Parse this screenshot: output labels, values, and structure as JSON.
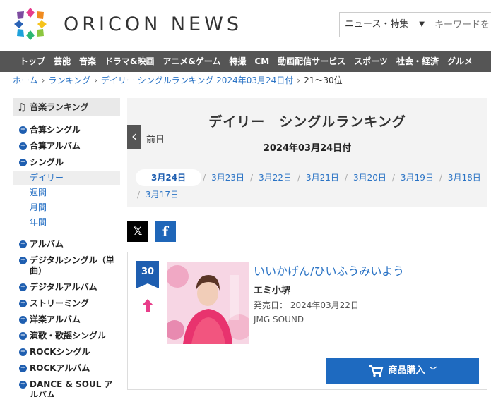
{
  "header": {
    "logo_text": "ORICON NEWS",
    "search_category": "ニュース・特集",
    "search_placeholder": "キーワードを"
  },
  "nav": {
    "items": [
      "トップ",
      "芸能",
      "音楽",
      "ドラマ&映画",
      "アニメ&ゲーム",
      "特撮",
      "CM",
      "動画配信サービス",
      "スポーツ",
      "社会・経済",
      "グルメ"
    ]
  },
  "breadcrumb": {
    "items": [
      "ホーム",
      "ランキング",
      "デイリー シングルランキング 2024年03月24日付"
    ],
    "current": "21～30位"
  },
  "sidebar": {
    "title": "音楽ランキング",
    "items": [
      {
        "label": "合算シングル",
        "mark": "+"
      },
      {
        "label": "合算アルバム",
        "mark": "+"
      },
      {
        "label": "シングル",
        "mark": "−"
      },
      {
        "label": "アルバム",
        "mark": "+"
      },
      {
        "label": "デジタルシングル（単曲）",
        "mark": "+"
      },
      {
        "label": "デジタルアルバム",
        "mark": "+"
      },
      {
        "label": "ストリーミング",
        "mark": "+"
      },
      {
        "label": "洋楽アルバム",
        "mark": "+"
      },
      {
        "label": "演歌・歌謡シングル",
        "mark": "+"
      },
      {
        "label": "ROCKシングル",
        "mark": "+"
      },
      {
        "label": "ROCKアルバム",
        "mark": "+"
      },
      {
        "label": "DANCE & SOUL アルバム",
        "mark": "+"
      }
    ],
    "subitems": [
      "デイリー",
      "週間",
      "月間",
      "年間"
    ]
  },
  "ranking": {
    "title": "デイリー　シングルランキング",
    "date": "2024年03月24日付",
    "prev_label": "前日",
    "dates": [
      "3月24日",
      "3月23日",
      "3月22日",
      "3月21日",
      "3月20日",
      "3月19日",
      "3月18日",
      "3月17日"
    ]
  },
  "item": {
    "rank": "30",
    "title": "いいかげん/ひいふうみいよう",
    "artist": "エミ小堺",
    "release_label": "発売日：",
    "release_date": "2024年03月22日",
    "label": "JMG SOUND",
    "buy_label": "商品購入",
    "trend": "up"
  },
  "colors": {
    "accent_blue": "#1e5eb0",
    "link_blue": "#2a73c5",
    "nav_bg": "#555555",
    "trend_up": "#e83d8a"
  },
  "icons": [
    "logo-icon",
    "chevron-down-icon",
    "music-note-icon",
    "chevron-left-icon",
    "x-logo-icon",
    "facebook-icon",
    "up-arrow-icon",
    "cart-icon"
  ]
}
